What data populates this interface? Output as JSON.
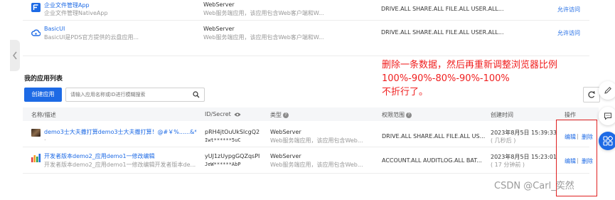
{
  "top_apps": [
    {
      "name": "企业文件管理App",
      "desc": "企业文件管理NativeApp",
      "type": "WebServer",
      "type_desc": "Web服务端应用，该应用包含Web客户端和W...",
      "scope": "DRIVE.ALL SHARE.ALL FILE.ALL USER.ALL...",
      "action": "允许访问"
    },
    {
      "name": "BasicUI",
      "desc": "BasicUI是PDS官方提供的云盘应用...",
      "type": "WebServer",
      "type_desc": "Web服务端应用，该应用包含Web客户端和W...",
      "scope": "DRIVE.ALL SHARE.ALL FILE.ALL USER.ALL...",
      "action": "允许访问"
    }
  ],
  "my_apps": {
    "section_title": "我的应用列表",
    "create_button": "创建应用",
    "search_placeholder": "请输入应用名称或ID进行模糊搜索",
    "columns": {
      "name": "名称/描述",
      "id": "ID/Secret",
      "type": "类型",
      "scope": "权限范围",
      "created": "创建时间",
      "actions": "操作"
    },
    "rows": [
      {
        "name": "demo3士大夫撒打算demo3士大夫撒打算！@#￥%......&*",
        "desc": ".",
        "id": "pRH4jtOuUkSlcgQ2",
        "secret": "Iwt******5uC",
        "type": "WebServer",
        "type_desc": "Web服务端应用，该应用包含Web...",
        "scope": "DRIVE.ALL  SHARE.ALL  FILE.ALL  US...",
        "created": "2023年8月5日 15:39:33",
        "created_ago": "( 几秒后 )",
        "edit": "编辑",
        "delete": "删除"
      },
      {
        "name": "开发者版本demo2_应用demo1一修改编辑",
        "desc": "开发者版本demo2_应用demo1一修改编辑开发者版本de...",
        "id": "yUJ1zUypgGQZqsPI",
        "secret": "JeW******AbP",
        "type": "WebServer",
        "type_desc": "Web服务端应用，该应用包含Web...",
        "scope": "ACCOUNT.ALL  AUDITLOG.ALL  BAT...",
        "created": "2023年8月5日 15:23:01",
        "created_ago": "( 17 分钟前 )",
        "edit": "编辑",
        "delete": "删除"
      }
    ]
  },
  "annotation": {
    "line1": "删除一条数据，然后再重新调整浏览器比例",
    "line2": "100%-90%-80%-90%-100%",
    "line3": "不折行了。"
  },
  "watermark": "CSDN @Carl_奕然",
  "colors": {
    "accent": "#1d6ae5",
    "annotation": "#f02020"
  }
}
